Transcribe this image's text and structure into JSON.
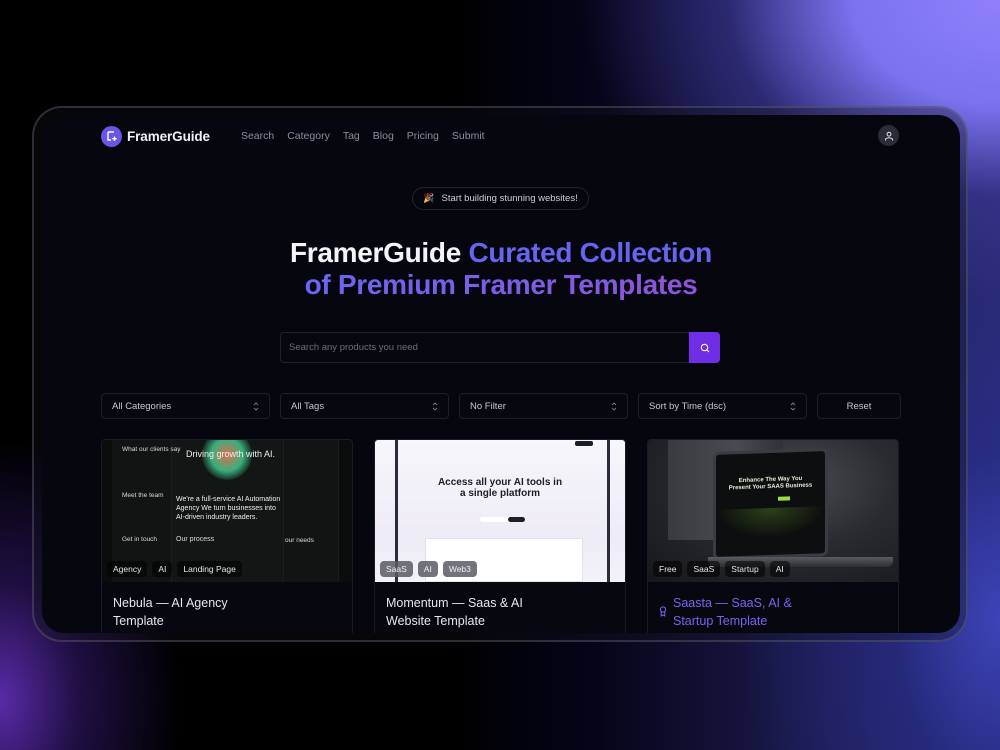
{
  "nav": {
    "brand": "FramerGuide",
    "links": [
      "Search",
      "Category",
      "Tag",
      "Blog",
      "Pricing",
      "Submit"
    ],
    "user_icon": "user-icon"
  },
  "hero": {
    "badge_emoji": "🎉",
    "badge_text": "Start building stunning websites!",
    "title_white": "FramerGuide",
    "title_blue": "Curated Collection",
    "title_line2": "of Premium Framer Templates"
  },
  "search": {
    "placeholder": "Search any products you need",
    "value": "",
    "button_icon": "search-icon"
  },
  "filters": {
    "category": "All Categories",
    "tags": "All Tags",
    "filter": "No Filter",
    "sort": "Sort by Time (dsc)",
    "reset_label": "Reset"
  },
  "cards": [
    {
      "title_line1": "Nebula — AI Agency",
      "title_line2": "Template",
      "tags": [
        "Agency",
        "AI",
        "Landing Page"
      ],
      "featured": false,
      "preview": {
        "heading": "Driving growth with AI.",
        "body": "We're a full-service AI Automation Agency We turn businesses into AI-driven industry leaders.",
        "labels": [
          "What our clients say",
          "Meet the team",
          "Get in touch",
          "Our process",
          "our needs"
        ]
      }
    },
    {
      "title_line1": "Momentum — Saas & AI",
      "title_line2": "Website Template",
      "tags": [
        "SaaS",
        "AI",
        "Web3"
      ],
      "featured": false,
      "preview": {
        "heading_line1": "Access all your AI tools in",
        "heading_line2": "a single platform"
      }
    },
    {
      "title_line1": "Saasta — SaaS, AI &",
      "title_line2": "Startup Template",
      "tags": [
        "Free",
        "SaaS",
        "Startup",
        "AI"
      ],
      "featured": true,
      "preview": {
        "heading_line1": "Enhance The Way You",
        "heading_line2": "Present Your SAAS Business"
      }
    }
  ],
  "colors": {
    "accent": "#6f2ee6",
    "brand": "#6756e8",
    "featured_title": "#7a63f0"
  }
}
